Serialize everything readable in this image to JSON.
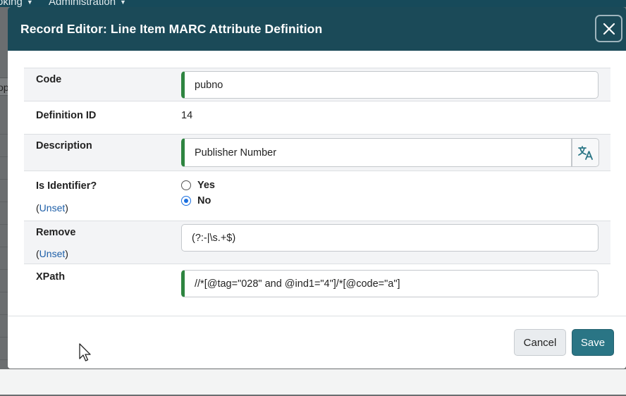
{
  "background": {
    "nav_items": [
      "oking",
      "Administration"
    ],
    "left_tab_text": "op"
  },
  "modal": {
    "title": "Record Editor: Line Item MARC Attribute Definition",
    "close_icon": "close-icon"
  },
  "fields": {
    "code": {
      "label": "Code",
      "value": "pubno"
    },
    "definition_id": {
      "label": "Definition ID",
      "value": "14"
    },
    "description": {
      "label": "Description",
      "value": "Publisher Number",
      "translate_icon": "translate-icon"
    },
    "is_identifier": {
      "label": "Is Identifier?",
      "unset_open": "(",
      "unset_link": "Unset",
      "unset_close": ")",
      "options": [
        {
          "label": "Yes",
          "checked": false
        },
        {
          "label": "No",
          "checked": true
        }
      ]
    },
    "remove": {
      "label": "Remove",
      "value": "(?:-|\\s.+$)",
      "unset_open": "(",
      "unset_link": "Unset",
      "unset_close": ")"
    },
    "xpath": {
      "label": "XPath",
      "value": "//*[@tag=\"028\" and @ind1=\"4\"]/*[@code=\"a\"]"
    }
  },
  "footer": {
    "cancel_label": "Cancel",
    "save_label": "Save"
  },
  "colors": {
    "header_bg": "#1b4a58",
    "required_border": "#2e8540",
    "save_bg": "#2a7585",
    "link": "#1e5fa8"
  }
}
